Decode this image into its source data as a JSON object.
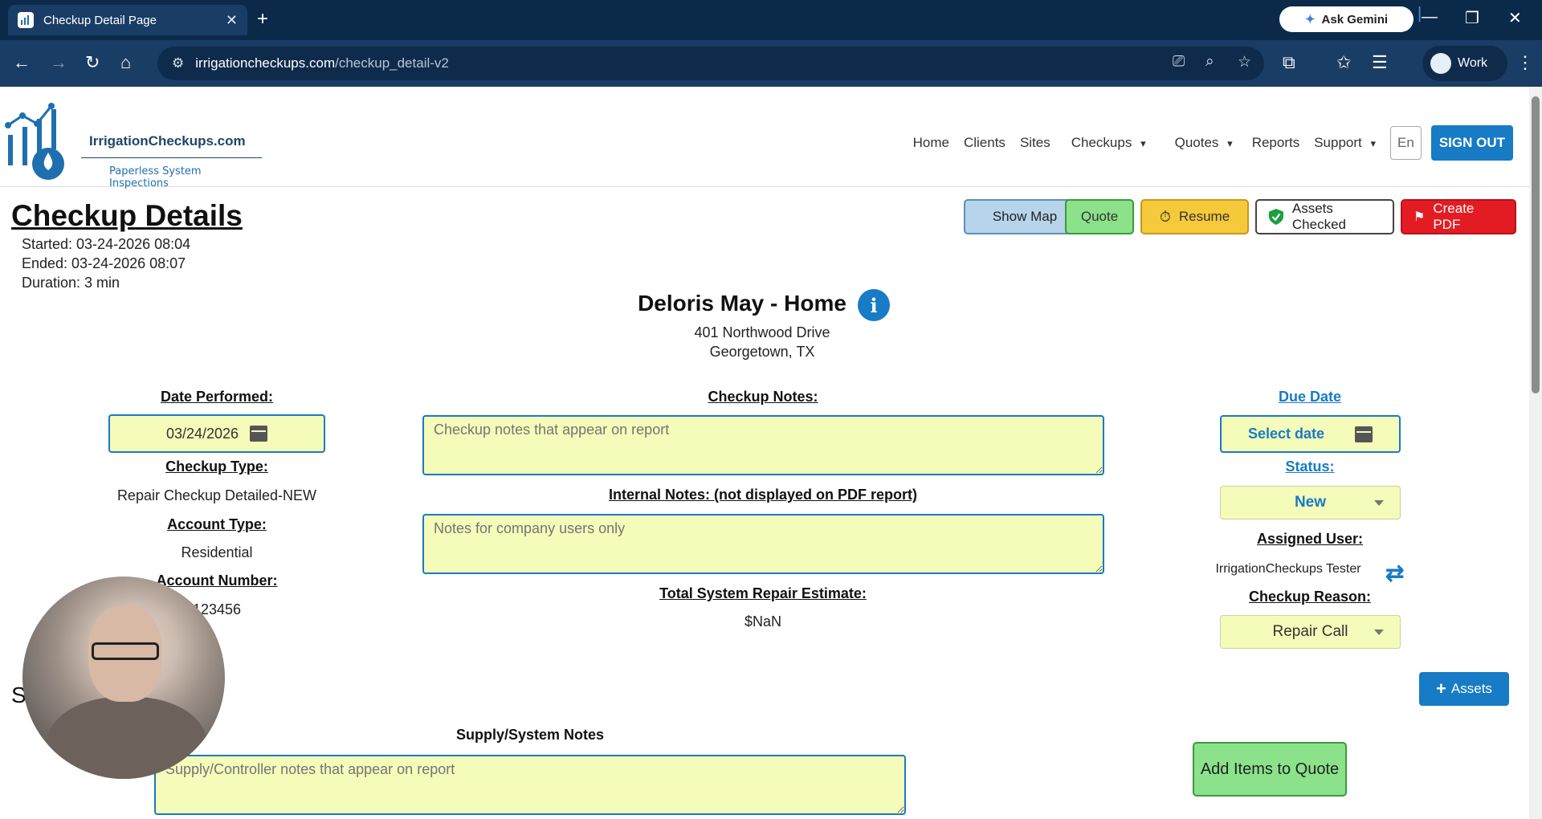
{
  "browser": {
    "tab_title": "Checkup Detail Page",
    "tab_close": "✕",
    "new_tab": "+",
    "gemini_label": "Ask Gemini",
    "url_host": "irrigationcheckups.com",
    "url_path": "/checkup_detail-v2",
    "profile_label": "Work"
  },
  "header": {
    "brand_name": "IrrigationCheckups.com",
    "brand_tagline": "Paperless System Inspections",
    "nav": {
      "home": "Home",
      "clients": "Clients",
      "sites": "Sites",
      "checkups": "Checkups",
      "quotes": "Quotes",
      "reports": "Reports",
      "support": "Support",
      "lang": "En",
      "signout": "SIGN OUT"
    }
  },
  "page": {
    "title": "Checkup Details",
    "started": "Started: 03-24-2026 08:04",
    "ended": "Ended: 03-24-2026 08:07",
    "duration": "Duration: 3 min"
  },
  "actions": {
    "show_map": "Show Map",
    "quote": "Quote",
    "resume": "Resume",
    "assets_checked": "Assets Checked",
    "create_pdf": "Create PDF"
  },
  "site": {
    "name": "Deloris May - Home",
    "address1": "401 Northwood Drive",
    "address2": "Georgetown, TX"
  },
  "left": {
    "date_label": "Date Performed:",
    "date_value": "03/24/2026",
    "type_label": "Checkup Type:",
    "type_value": "Repair Checkup Detailed-NEW",
    "account_type_label": "Account Type:",
    "account_type_value": "Residential",
    "account_number_label": "Account Number:",
    "account_number_value": "123456"
  },
  "center": {
    "notes_label": "Checkup Notes:",
    "notes_placeholder": "Checkup notes that appear on report",
    "internal_label": "Internal Notes: (not displayed on PDF report)",
    "internal_placeholder": "Notes for company users only",
    "estimate_label": "Total System Repair Estimate:",
    "estimate_value": "$NaN"
  },
  "right": {
    "due_label": "Due Date",
    "due_placeholder": "Select date",
    "status_label": "Status:",
    "status_value": "New",
    "assigned_label": "Assigned User:",
    "assigned_value": "IrrigationCheckups Tester",
    "reason_label": "Checkup Reason:",
    "reason_value": "Repair Call",
    "plus_assets": "Assets",
    "add_items": "Add Items to Quote"
  },
  "supply": {
    "section_initial": "S",
    "label": "Supply/System Notes",
    "placeholder": "Supply/Controller notes that appear on report"
  },
  "colors": {
    "accent": "#177bc6",
    "field_bg": "#f5fbb9",
    "danger": "#e31c23",
    "success": "#8be28b",
    "warning": "#f6c93a"
  }
}
